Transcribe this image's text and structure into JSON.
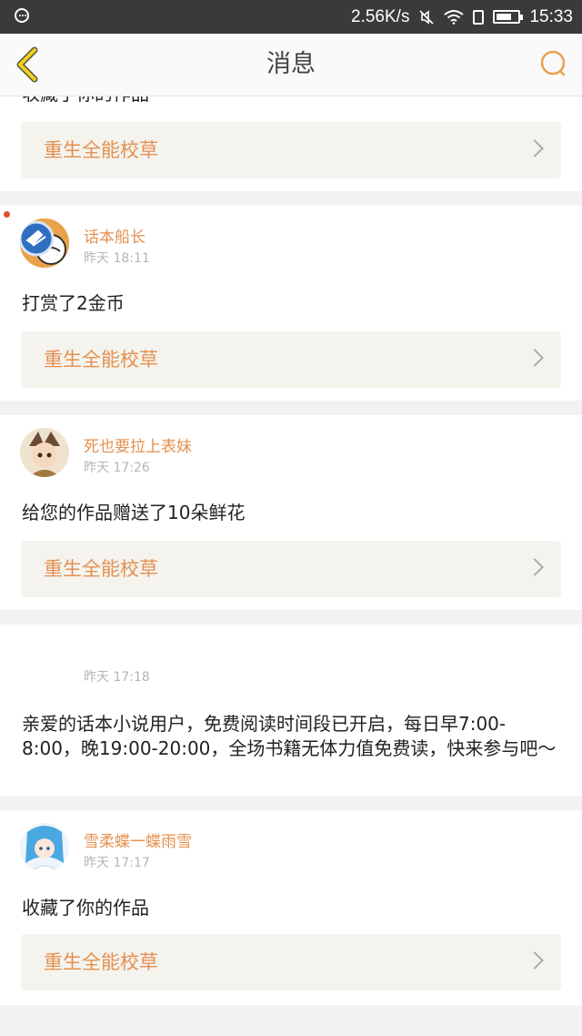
{
  "status_bar": {
    "network_speed": "2.56K/s",
    "time": "15:33",
    "icons": [
      "menu-icon",
      "mute-icon",
      "wifi-icon",
      "sim-icon",
      "battery-icon"
    ]
  },
  "nav": {
    "title": "消息",
    "back_icon": "back-chevron-icon",
    "search_icon": "search-icon",
    "accent_color": "#e6c200"
  },
  "messages": [
    {
      "username": "",
      "time": "",
      "text": "收藏了你的作品",
      "work_title": "重生全能校草"
    },
    {
      "username": "话本船长",
      "time": "昨天 18:11",
      "text": "打赏了2金币",
      "work_title": "重生全能校草",
      "unread": true
    },
    {
      "username": "死也要拉上表妹",
      "time": "昨天 17:26",
      "text": "给您的作品赠送了10朵鲜花",
      "work_title": "重生全能校草"
    },
    {
      "username": "",
      "time": "昨天 17:18",
      "text": "亲爱的话本小说用户，免费阅读时间段已开启，每日早7:00-8:00，晚19:00-20:00，全场书籍无体力值免费读，快来参与吧～"
    },
    {
      "username": "雪柔蝶一蝶雨雪",
      "time": "昨天 17:17",
      "text": "收藏了你的作品",
      "work_title": "重生全能校草"
    }
  ],
  "colors": {
    "username": "#e4904f",
    "work_title": "#e4904f",
    "timestamp": "#b5b5b5",
    "unread_dot": "#e64a2e"
  }
}
